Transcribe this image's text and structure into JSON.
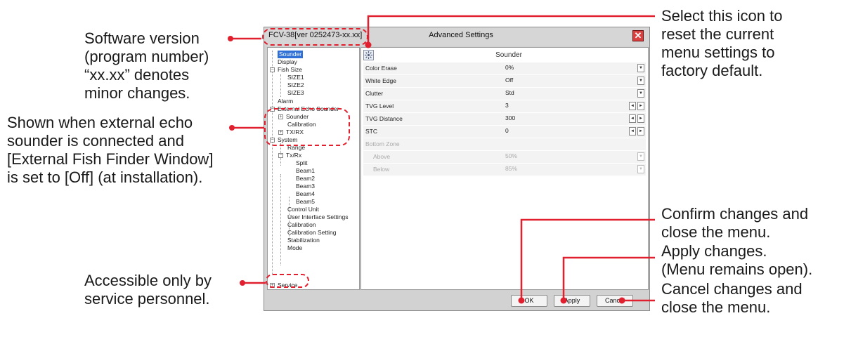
{
  "annotations": {
    "version": "Software version\n(program number)\n“xx.xx” denotes\nminor changes.",
    "echo": "Shown when external echo\nsounder is connected and\n[External Fish Finder Window]\nis set to [Off] (at installation).",
    "service": "Accessible only by\nservice personnel.",
    "reset": "Select this icon to\nreset the current\nmenu settings to\nfactory default.",
    "ok": "Confirm changes and\nclose the menu.",
    "apply": "Apply changes.\n(Menu remains open).",
    "cancel": "Cancel changes and\nclose the menu."
  },
  "window": {
    "version": "FCV-38[ver 0252473-xx.xx]",
    "title": "Advanced Settings",
    "close": "✕"
  },
  "tree": {
    "sounder": "Sounder",
    "display": "Display",
    "fish_size": "Fish Size",
    "size1": "SIZE1",
    "size2": "SIZE2",
    "size3": "SIZE3",
    "alarm": "Alarm",
    "ext_echo": "External Echo Sounder",
    "ext_sounder": "Sounder",
    "calibration": "Calibration",
    "txrx": "TX/RX",
    "system": "System",
    "range": "Range",
    "txrx2": "Tx/Rx",
    "split": "Split",
    "beam1": "Beam1",
    "beam2": "Beam2",
    "beam3": "Beam3",
    "beam4": "Beam4",
    "beam5": "Beam5",
    "control_unit": "Control Unit",
    "ui_settings": "User Interface Settings",
    "calibration2": "Calibration",
    "calib_setting": "Calibration Setting",
    "stabilization": "Stabilization",
    "mode": "Mode",
    "service": "Service"
  },
  "panel": {
    "heading": "Sounder",
    "rows": [
      {
        "label": "Color Erase",
        "value": "0%"
      },
      {
        "label": "White Edge",
        "value": "Off"
      },
      {
        "label": "Clutter",
        "value": "Std"
      },
      {
        "label": "TVG Level",
        "value": "3"
      },
      {
        "label": "TVG Distance",
        "value": "300"
      },
      {
        "label": "STC",
        "value": "0"
      },
      {
        "label": "Bottom Zone",
        "value": ""
      },
      {
        "label": "Above",
        "value": "50%"
      },
      {
        "label": "Below",
        "value": "85%"
      }
    ]
  },
  "buttons": {
    "ok": "OK",
    "apply": "Apply",
    "cancel": "Cancel"
  },
  "colors": {
    "callout_red": "#e0202f",
    "selection_blue": "#2f6fd6",
    "window_gray": "#d2d2d2"
  }
}
